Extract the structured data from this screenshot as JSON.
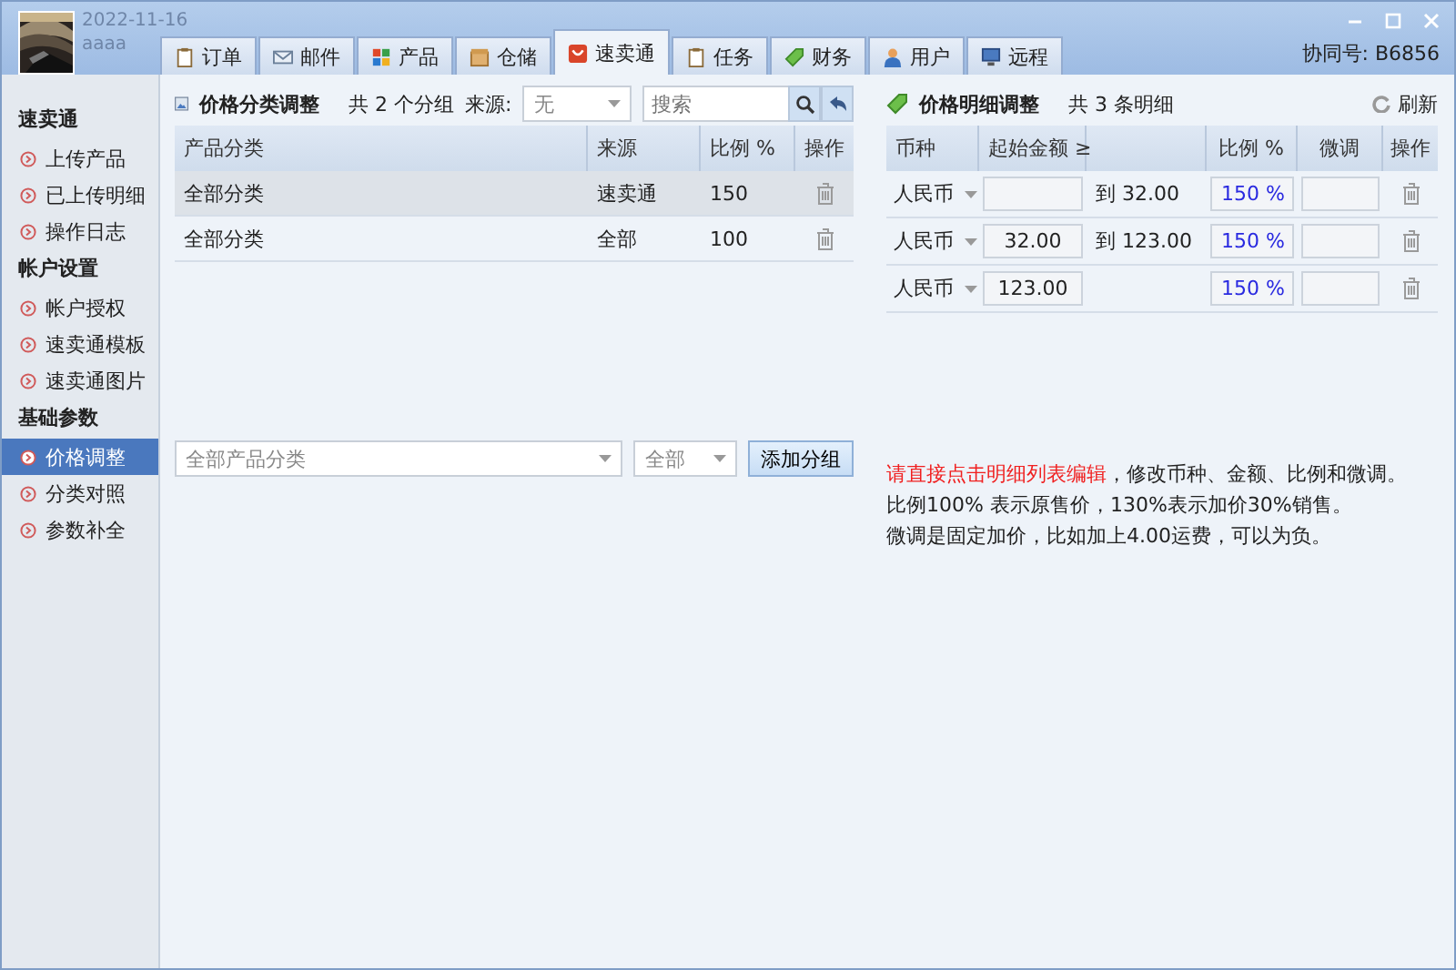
{
  "header": {
    "date": "2022-11-16",
    "user": "aaaa",
    "sync_label": "协同号: B6856"
  },
  "tabs": [
    {
      "label": "订单",
      "selected": false
    },
    {
      "label": "邮件",
      "selected": false
    },
    {
      "label": "产品",
      "selected": false
    },
    {
      "label": "仓储",
      "selected": false
    },
    {
      "label": "速卖通",
      "selected": true
    },
    {
      "label": "任务",
      "selected": false
    },
    {
      "label": "财务",
      "selected": false
    },
    {
      "label": "用户",
      "selected": false
    },
    {
      "label": "远程",
      "selected": false
    }
  ],
  "sidebar": [
    {
      "title": "速卖通",
      "items": [
        {
          "label": "上传产品",
          "selected": false
        },
        {
          "label": "已上传明细",
          "selected": false
        },
        {
          "label": "操作日志",
          "selected": false
        }
      ]
    },
    {
      "title": "帐户设置",
      "items": [
        {
          "label": "帐户授权",
          "selected": false
        },
        {
          "label": "速卖通模板",
          "selected": false
        },
        {
          "label": "速卖通图片",
          "selected": false
        }
      ]
    },
    {
      "title": "基础参数",
      "items": [
        {
          "label": "价格调整",
          "selected": true
        },
        {
          "label": "分类对照",
          "selected": false
        },
        {
          "label": "参数补全",
          "selected": false
        }
      ]
    }
  ],
  "category_panel": {
    "title": "价格分类调整",
    "count": "共 2 个分组",
    "source_label": "来源:",
    "source_value": "无",
    "search": {
      "placeholder": "搜索"
    },
    "columns": [
      "产品分类",
      "来源",
      "比例 %",
      "操作"
    ],
    "rows": [
      {
        "category": "全部分类",
        "source": "速卖通",
        "ratio": "150",
        "selected": true
      },
      {
        "category": "全部分类",
        "source": "全部",
        "ratio": "100",
        "selected": false
      }
    ],
    "add_form": {
      "category_placeholder": "全部产品分类",
      "source_placeholder": "全部",
      "button": "添加分组"
    }
  },
  "detail_panel": {
    "title": "价格明细调整",
    "count": "共 3 条明细",
    "refresh": "刷新",
    "columns": [
      "币种",
      "起始金额 ≥",
      "比例 %",
      "微调",
      "操作"
    ],
    "rows": [
      {
        "currency": "人民币",
        "to": "到 32.00",
        "ratio": "150 %"
      },
      {
        "currency": "人民币",
        "start": "32.00",
        "to": "到 123.00",
        "ratio": "150 %"
      },
      {
        "currency": "人民币",
        "start": "123.00",
        "ratio": "150 %"
      }
    ],
    "notes": [
      {
        "highlight": "请直接点击明细列表编辑",
        "text": "，修改币种、金额、比例和微调。"
      },
      {
        "text": "比例100% 表示原售价，130%表示加价30%销售。"
      },
      {
        "text": "微调是固定加价，比如加上4.00运费，可以为负。"
      }
    ]
  }
}
